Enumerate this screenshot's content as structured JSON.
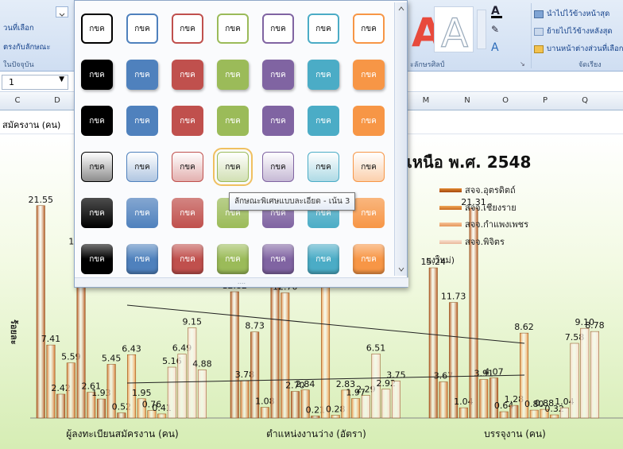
{
  "ribbon": {
    "left_items": [
      "วนที่เลือก",
      "ตรงกับลักษณะ",
      "ในปัจจุบัน"
    ],
    "wordart_group_label": "ะลักษรศิลป์",
    "arrange_items": [
      "นำไปไว้ข้างหน้าสุด",
      "ย้ายไปไว้ข้างหลังสุด",
      "บานหน้าต่างส่วนที่เลือก"
    ],
    "arrange_group_label": "จัดเรียง",
    "wordart_letter": "A"
  },
  "formula_bar": {
    "name_box": "1"
  },
  "columns_left": [
    "C",
    "D"
  ],
  "columns_right": [
    "M",
    "N",
    "O",
    "P",
    "Q"
  ],
  "cell_text": "สมัครงาน (คน)",
  "gallery": {
    "swatch_label": "กขค",
    "selected": {
      "row": 3,
      "col": 3
    },
    "tooltip": "ลักษณะพิเศษแบบละเอียด - เน้น 3",
    "footer": "....",
    "row_styles": [
      "outline",
      "flat",
      "flat-dark",
      "light",
      "gradient",
      "bevel"
    ],
    "colors": [
      "#000000",
      "#4f81bd",
      "#c0504d",
      "#9bbb59",
      "#8064a2",
      "#4bacc6",
      "#f79646"
    ]
  },
  "chart_data": {
    "type": "bar",
    "title": "เหนือ พ.ศ. 2548",
    "subtitle": "ยงใหม่)",
    "ylabel": "ร้อยละ",
    "categories": [
      "ผู้ลงทะเบียนสมัครงาน (คน)",
      "ตำแหน่งงานว่าง (อัตรา)",
      "บรรจุงาน (คน)"
    ],
    "legend_visible": [
      "สจจ.อุตรดิตถ์",
      "สจจ.เชียงราย",
      "สจจ.กำแพงเพชร",
      "สจจ.พิจิตร"
    ],
    "series_values": [
      [
        21.55,
        7.41,
        2.42,
        5.59,
        17.31,
        2.61,
        1.93,
        5.45,
        0.52,
        6.43,
        1.95,
        0.76,
        0.41,
        5.16,
        6.49,
        9.15,
        4.88
      ],
      [
        12.82,
        3.78,
        8.73,
        1.08,
        17.16,
        12.7,
        2.7,
        2.84,
        0.21,
        17.43,
        0.28,
        2.83,
        1.97,
        2.29,
        6.51,
        2.92,
        3.75
      ],
      [
        15.24,
        3.67,
        11.73,
        1.04,
        21.31,
        3.91,
        4.07,
        0.64,
        1.28,
        8.62,
        0.8,
        0.88,
        0.32,
        1.04,
        7.58,
        9.1,
        8.78
      ]
    ],
    "ylim": [
      0,
      23
    ],
    "colors": [
      "#b4561a",
      "#d4782e",
      "#ec9a48",
      "#f2bb8c",
      "#f6dcc7"
    ],
    "trendlines": true
  }
}
